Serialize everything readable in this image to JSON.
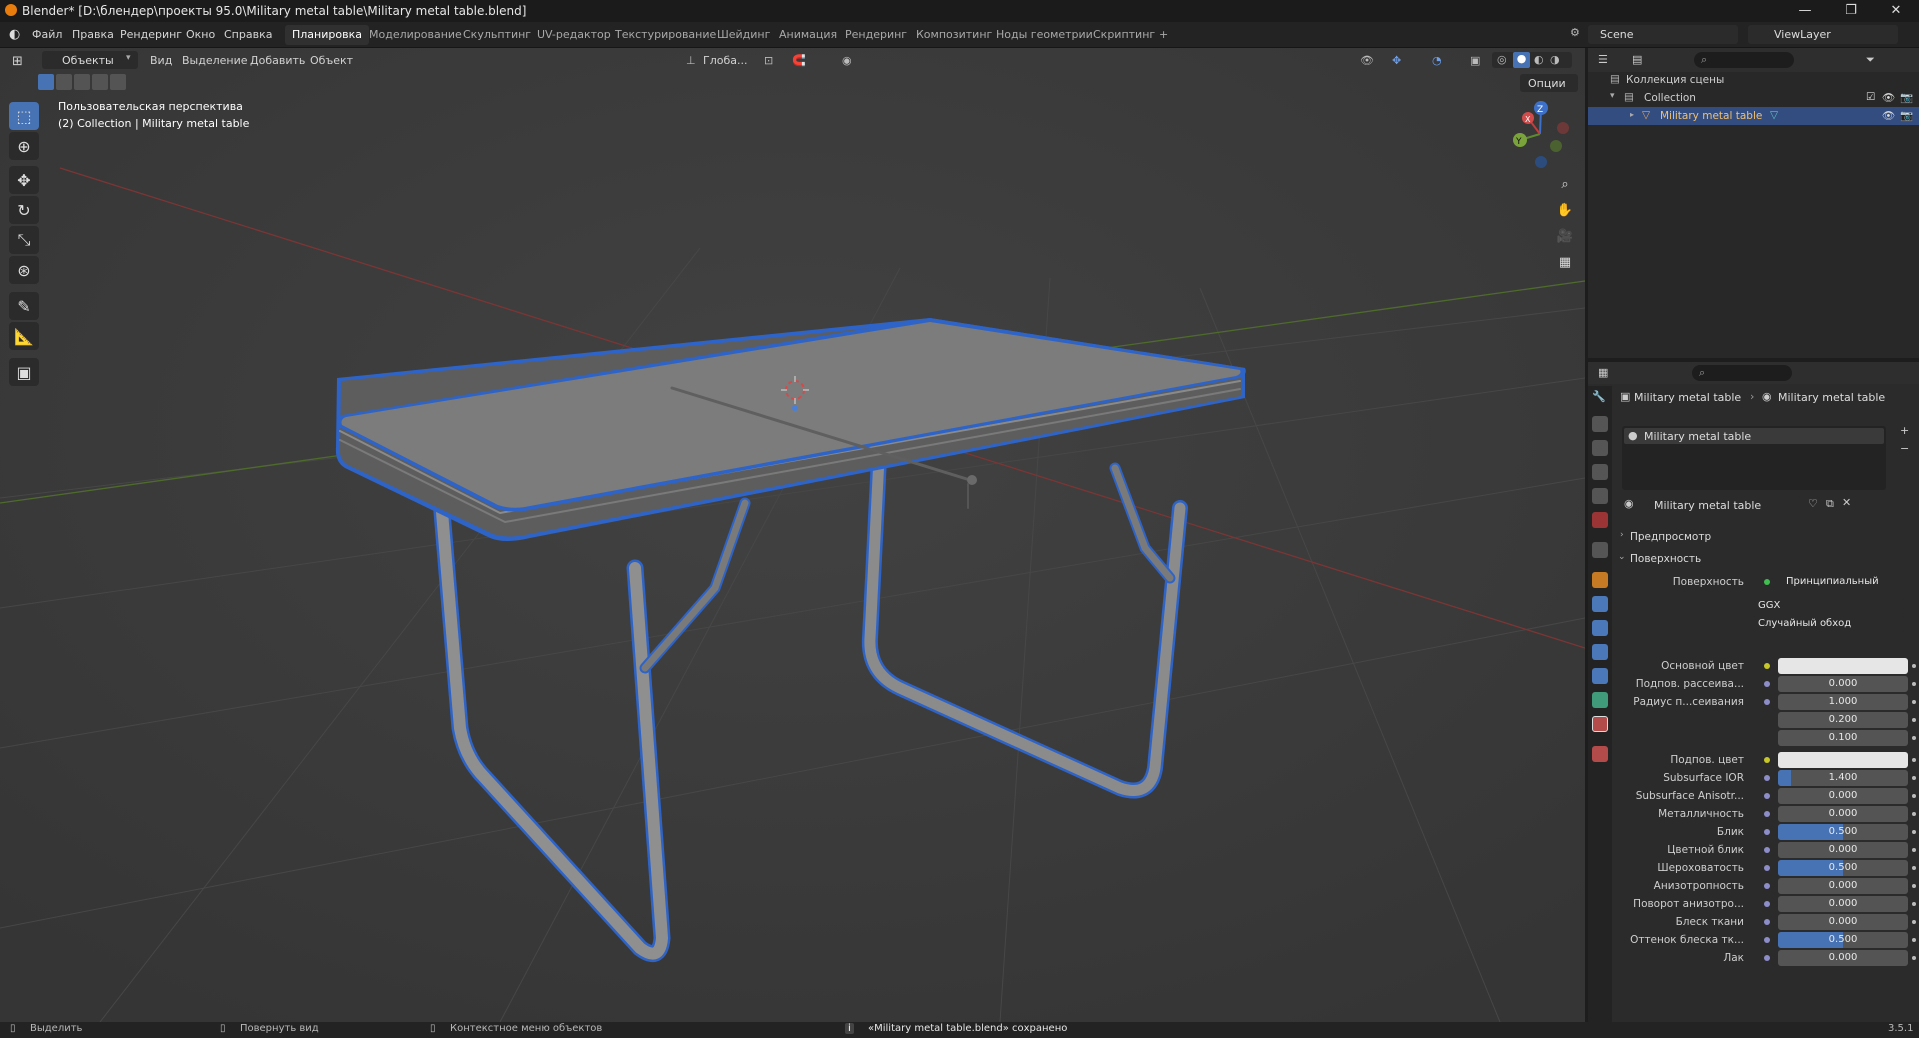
{
  "window": {
    "title": "Blender* [D:\\блендер\\проекты 95.0\\Military metal table\\Military metal table.blend]",
    "controls": [
      "—",
      "❐",
      "✕"
    ]
  },
  "menu": [
    "Файл",
    "Правка",
    "Рендеринг",
    "Окно",
    "Справка"
  ],
  "workspaces": [
    "Планировка",
    "Моделирование",
    "Скульптинг",
    "UV-редактор",
    "Текстурирование",
    "Шейдинг",
    "Анимация",
    "Рендеринг",
    "Композитинг",
    "Ноды геометрии",
    "Скриптинг",
    "+"
  ],
  "scene": {
    "label": "Scene",
    "viewlayer": "ViewLayer"
  },
  "viewport": {
    "mode": "Объекты",
    "menus": [
      "Вид",
      "Выделение",
      "Добавить",
      "Объект"
    ],
    "transform_orientation": "Глоба...",
    "options": "Опции",
    "info_line1": "Пользовательская перспектива",
    "info_line2": "(2) Collection | Military metal table",
    "gizmo": {
      "x": "X",
      "y": "Y",
      "z": "Z"
    }
  },
  "outliner": {
    "rows": [
      {
        "label": "Коллекция сцены"
      },
      {
        "label": "Collection"
      },
      {
        "label": "Military metal table"
      }
    ]
  },
  "properties": {
    "breadcrumb_object": "Military metal table",
    "breadcrumb_material": "Military metal table",
    "slot": "Military metal table",
    "material_name": "Military metal table",
    "sections": {
      "preview": "Предпросмотр",
      "surface": "Поверхность"
    },
    "surface_label": "Поверхность",
    "surface_value": "Принципиальный BSDF",
    "distribution": "GGX",
    "subsurface_method": "Случайный обход",
    "rows": [
      {
        "label": "Основной цвет",
        "value": "",
        "type": "color",
        "fill": 0
      },
      {
        "label": "Подпов. рассеива...",
        "value": "0.000",
        "fill": 0
      },
      {
        "label": "Радиус п...сеивания",
        "value": "1.000",
        "fill": 0
      },
      {
        "label": "",
        "value": "0.200",
        "fill": 0
      },
      {
        "label": "",
        "value": "0.100",
        "fill": 0
      },
      {
        "label": "Подпов. цвет",
        "value": "",
        "type": "color",
        "fill": 0
      },
      {
        "label": "Subsurface IOR",
        "value": "1.400",
        "fill": 0.1
      },
      {
        "label": "Subsurface Anisotr...",
        "value": "0.000",
        "fill": 0
      },
      {
        "label": "Металличность",
        "value": "0.000",
        "fill": 0
      },
      {
        "label": "Блик",
        "value": "0.500",
        "fill": 0.5
      },
      {
        "label": "Цветной блик",
        "value": "0.000",
        "fill": 0
      },
      {
        "label": "Шероховатость",
        "value": "0.500",
        "fill": 0.5
      },
      {
        "label": "Анизотропность",
        "value": "0.000",
        "fill": 0
      },
      {
        "label": "Поворот анизотро...",
        "value": "0.000",
        "fill": 0
      },
      {
        "label": "Блеск ткани",
        "value": "0.000",
        "fill": 0
      },
      {
        "label": "Оттенок блеска тк...",
        "value": "0.500",
        "fill": 0.5
      },
      {
        "label": "Лак",
        "value": "0.000",
        "fill": 0
      }
    ]
  },
  "status": {
    "select": "Выделить",
    "rotate": "Повернуть вид",
    "context": "Контекстное меню объектов",
    "message": "«Military metal table.blend» сохранено",
    "version": "3.5.1"
  }
}
